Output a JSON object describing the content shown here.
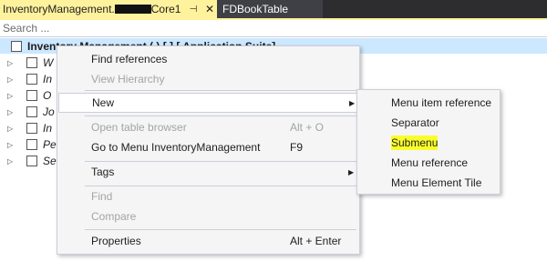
{
  "tabs": {
    "active": {
      "title_prefix": "InventoryManagement.",
      "title_suffix": "Core1",
      "pin_glyph": "⊣",
      "close_glyph": "✕"
    },
    "second": {
      "title": "FDBookTable"
    }
  },
  "search": {
    "placeholder": "Search ..."
  },
  "tree": {
    "root_label": "Inventory Management     (   )   [        ]  [        Application Suite]",
    "children": [
      {
        "label": "W"
      },
      {
        "label": "In"
      },
      {
        "label": "O"
      },
      {
        "label": "Jo"
      },
      {
        "label": "In"
      },
      {
        "label": "Pe"
      },
      {
        "label": "Se"
      }
    ]
  },
  "context_menu": {
    "items": [
      {
        "label": "Find references",
        "enabled": true
      },
      {
        "label": "View Hierarchy",
        "enabled": false
      },
      {
        "label": "New",
        "enabled": true,
        "submenu": true,
        "hovered": true
      },
      {
        "label": "Open table browser",
        "shortcut": "Alt + O",
        "enabled": false
      },
      {
        "label": "Go to Menu InventoryManagement",
        "shortcut": "F9",
        "enabled": true
      },
      {
        "label": "Tags",
        "enabled": true,
        "submenu": true
      },
      {
        "label": "Find",
        "enabled": false
      },
      {
        "label": "Compare",
        "enabled": false
      },
      {
        "label": "Properties",
        "shortcut": "Alt + Enter",
        "enabled": true
      }
    ]
  },
  "submenu": {
    "items": [
      {
        "label": "Menu item reference"
      },
      {
        "label": "Separator"
      },
      {
        "label": "Submenu",
        "highlighted": true
      },
      {
        "label": "Menu reference"
      },
      {
        "label": "Menu Element Tile"
      }
    ]
  },
  "colors": {
    "active_tab": "#fff29d",
    "tab_strip": "#2d2d30",
    "selected_row": "#cce8ff",
    "highlight": "#f9ff2c",
    "menu_bg": "#f5f5f5",
    "disabled_text": "#a2a4a5"
  }
}
